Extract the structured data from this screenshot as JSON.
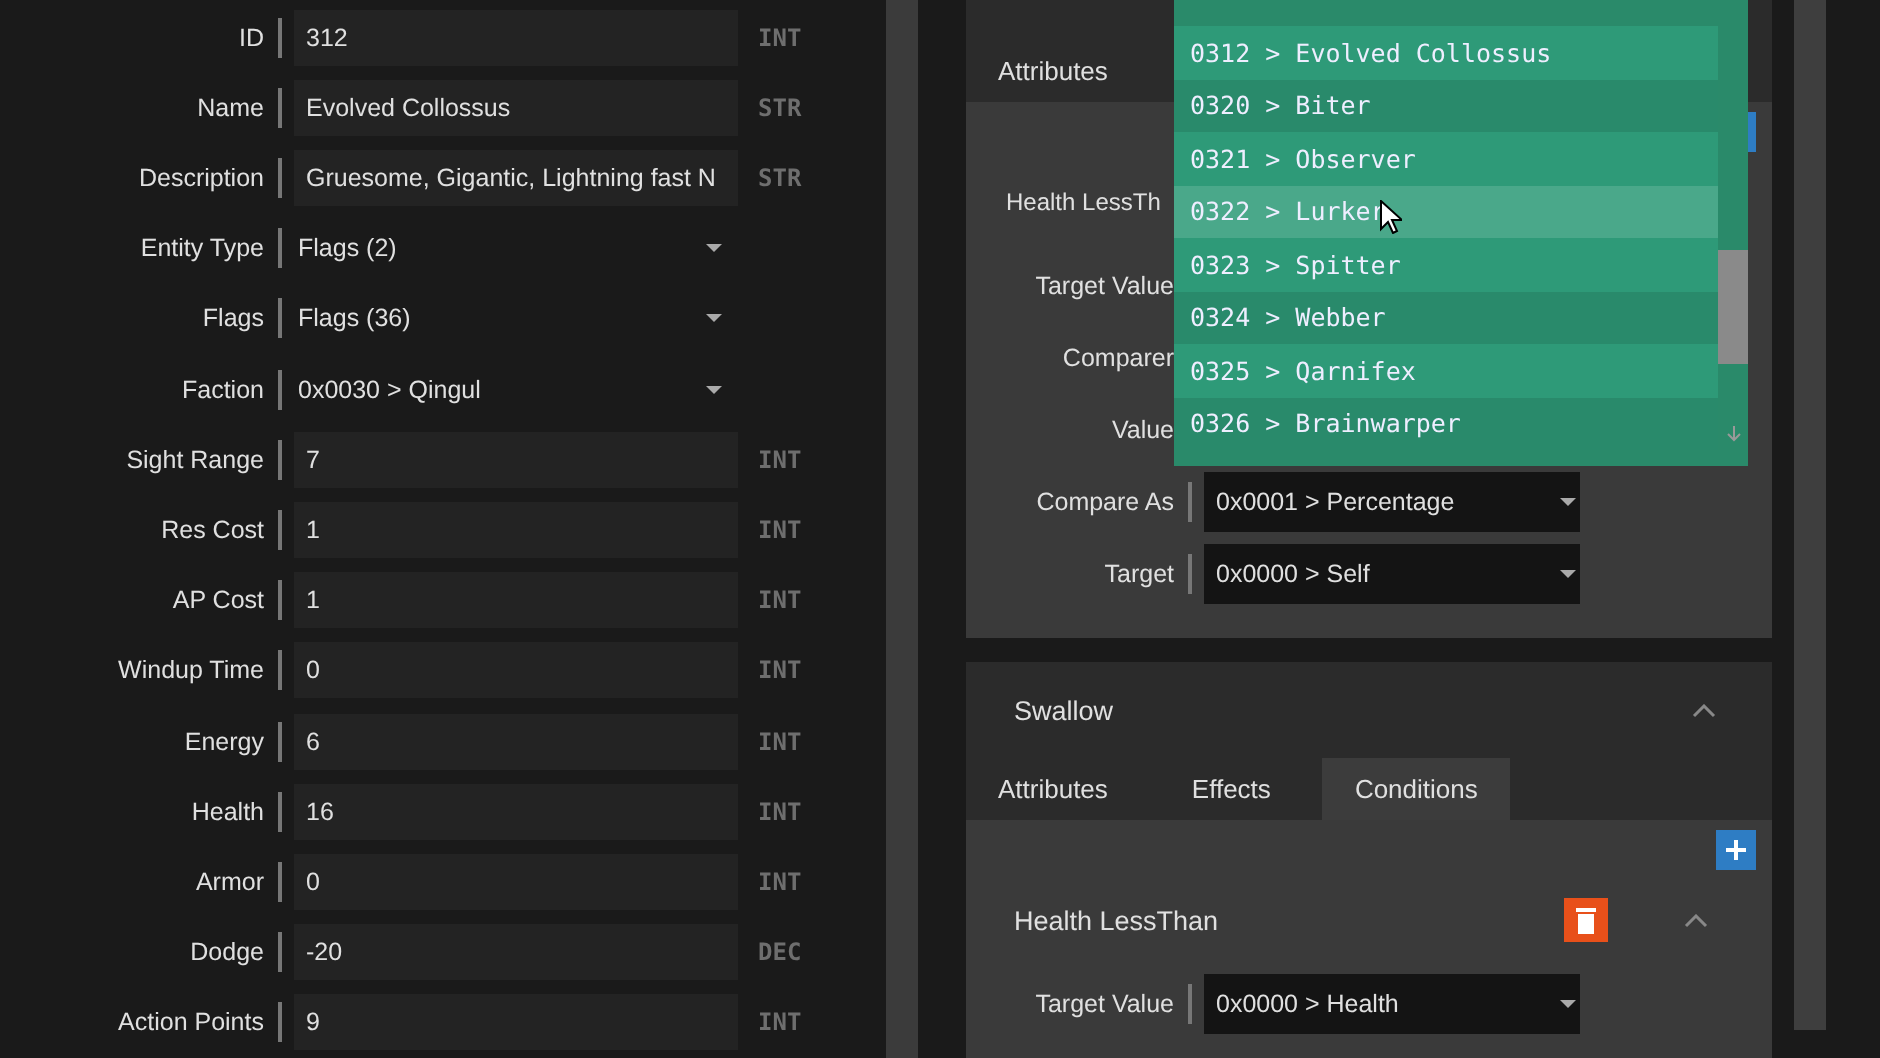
{
  "entity_form": {
    "fields": [
      {
        "label": "ID",
        "kind": "input",
        "value": "312",
        "type": "INT"
      },
      {
        "label": "Name",
        "kind": "input",
        "value": "Evolved Collossus",
        "type": "STR"
      },
      {
        "label": "Description",
        "kind": "input",
        "value": "Gruesome, Gigantic, Lightning fast N",
        "type": "STR"
      },
      {
        "label": "Entity Type",
        "kind": "select",
        "value": "Flags (2)"
      },
      {
        "label": "Flags",
        "kind": "select",
        "value": "Flags (36)"
      },
      {
        "label": "Faction",
        "kind": "select",
        "value": "0x0030 > Qingul"
      },
      {
        "label": "Sight Range",
        "kind": "input",
        "value": "7",
        "type": "INT"
      },
      {
        "label": "Res Cost",
        "kind": "input",
        "value": "1",
        "type": "INT"
      },
      {
        "label": "AP Cost",
        "kind": "input",
        "value": "1",
        "type": "INT"
      },
      {
        "label": "Windup Time",
        "kind": "input",
        "value": "0",
        "type": "INT"
      },
      {
        "label": "Energy",
        "kind": "input",
        "value": "6",
        "type": "INT"
      },
      {
        "label": "Health",
        "kind": "input",
        "value": "16",
        "type": "INT"
      },
      {
        "label": "Armor",
        "kind": "input",
        "value": "0",
        "type": "INT"
      },
      {
        "label": "Dodge",
        "kind": "input",
        "value": "-20",
        "type": "DEC"
      },
      {
        "label": "Action Points",
        "kind": "input",
        "value": "9",
        "type": "INT"
      }
    ]
  },
  "abilities": [
    {
      "tabs": [
        {
          "label": "Attributes",
          "selected": false
        }
      ],
      "conditions": [
        {
          "title": "Health LessTh",
          "fields": [
            {
              "label": "Target Value"
            },
            {
              "label": "Comparer"
            },
            {
              "label": "Value"
            },
            {
              "label": "Compare As",
              "value": "0x0001 > Percentage"
            },
            {
              "label": "Target",
              "value": "0x0000 > Self"
            }
          ]
        }
      ]
    },
    {
      "title": "Swallow",
      "tabs": [
        {
          "label": "Attributes",
          "selected": false
        },
        {
          "label": "Effects",
          "selected": false
        },
        {
          "label": "Conditions",
          "selected": true
        }
      ],
      "conditions": [
        {
          "title": "Health LessThan",
          "fields": [
            {
              "label": "Target Value",
              "value": "0x0000 > Health"
            }
          ]
        }
      ]
    }
  ],
  "dropdown": {
    "items": [
      {
        "label": "0312 > Evolved Collossus",
        "highlighted": false
      },
      {
        "label": "0320 > Biter",
        "highlighted": false
      },
      {
        "label": "0321 > Observer",
        "highlighted": false
      },
      {
        "label": "0322 > Lurker",
        "highlighted": true
      },
      {
        "label": "0323 > Spitter",
        "highlighted": false
      },
      {
        "label": "0324 > Webber",
        "highlighted": false
      },
      {
        "label": "0325 > Qarnifex",
        "highlighted": false
      },
      {
        "label": "0326 > Brainwarper",
        "highlighted": false
      }
    ]
  }
}
